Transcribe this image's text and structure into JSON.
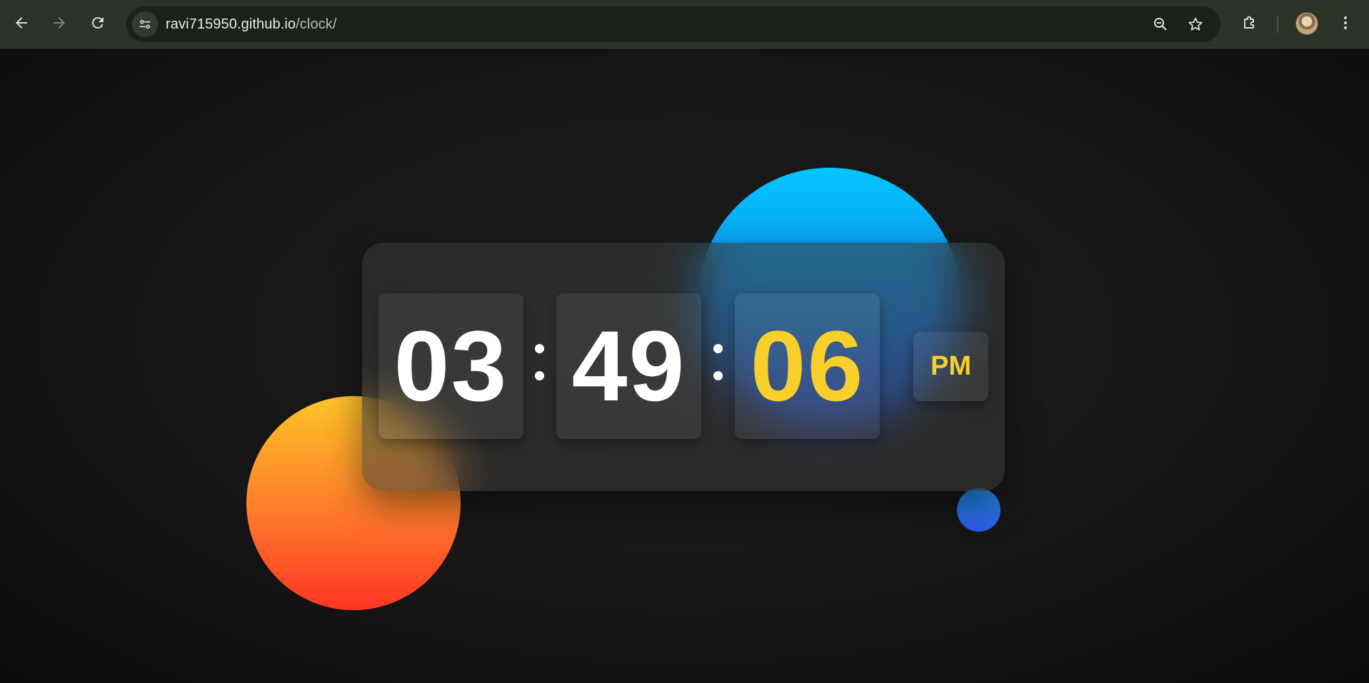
{
  "browser": {
    "url_host": "ravi715950.github.io",
    "url_path": "/clock/",
    "back_icon": "arrow-left-icon",
    "forward_icon": "arrow-right-icon",
    "reload_icon": "reload-icon",
    "site_info_icon": "tune-icon",
    "zoom_icon": "zoom-out-icon",
    "bookmark_icon": "star-icon",
    "extensions_icon": "puzzle-icon",
    "menu_icon": "kebab-menu-icon"
  },
  "clock": {
    "hours": "03",
    "minutes": "49",
    "seconds": "06",
    "period": "PM"
  },
  "colors": {
    "digit": "#ffffff",
    "accent": "#f9cf2b",
    "blob_orange_top": "#fdc42a",
    "blob_orange_bottom": "#ff3425",
    "blob_blue_top": "#03c6ff",
    "blob_blue_bottom": "#1f47d6"
  }
}
